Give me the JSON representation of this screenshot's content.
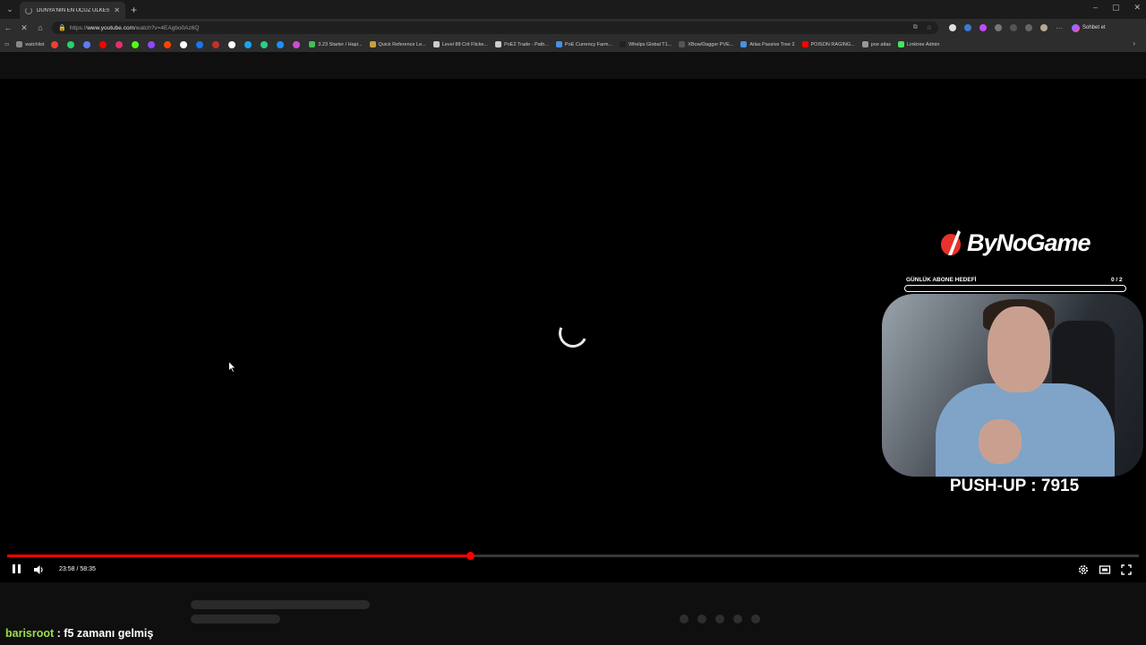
{
  "browser": {
    "tab_title": "DÜNYA'NIN EN UCUZ ÜLKESİ VİE",
    "url_prefix": "https://",
    "url_host": "www.youtube.com",
    "url_path": "/watch?v=4EAgbo0Az6Q",
    "chat_button": "Sohbet et",
    "window_controls": {
      "minimize": "–",
      "maximize": "▢",
      "close": "✕"
    }
  },
  "bookmarks": [
    {
      "label": "watchlist",
      "color": "#888888"
    },
    {
      "label": "",
      "color": "#ea4335"
    },
    {
      "label": "",
      "color": "#25d366"
    },
    {
      "label": "",
      "color": "#5b7cfa"
    },
    {
      "label": "",
      "color": "#ff0000"
    },
    {
      "label": "",
      "color": "#e1306c"
    },
    {
      "label": "",
      "color": "#53fc18"
    },
    {
      "label": "",
      "color": "#9146ff"
    },
    {
      "label": "",
      "color": "#ff4500"
    },
    {
      "label": "",
      "color": "#ffffff"
    },
    {
      "label": "",
      "color": "#1877f2"
    },
    {
      "label": "",
      "color": "#c4302b"
    },
    {
      "label": "",
      "color": "#ffffff"
    },
    {
      "label": "",
      "color": "#1da1f2"
    },
    {
      "label": "",
      "color": "#2dce89"
    },
    {
      "label": "",
      "color": "#1e90ff"
    },
    {
      "label": "",
      "color": "#d14bd1"
    },
    {
      "label": "3.23 Starter / Hapi...",
      "color": "#3fbf5a"
    },
    {
      "label": "Quick Reference Le...",
      "color": "#c8a13a"
    },
    {
      "label": "Level 88 Crit Flicke...",
      "color": "#cccccc"
    },
    {
      "label": "PoE2 Trade - Path...",
      "color": "#cccccc"
    },
    {
      "label": "PoE Currency Farm...",
      "color": "#4a90e2"
    },
    {
      "label": "Whelps Global T1...",
      "color": "#222222"
    },
    {
      "label": "XBow/Dagger PVE...",
      "color": "#555555"
    },
    {
      "label": "Atlas Passive Tree 2",
      "color": "#4a90e2"
    },
    {
      "label": "POISON RAGING...",
      "color": "#ff0000"
    },
    {
      "label": "poe atlas",
      "color": "#999999"
    },
    {
      "label": "Linktree Admin",
      "color": "#43e660"
    }
  ],
  "overlay": {
    "brand": "ByNoGame",
    "brand_color": "#e8322b",
    "goal_label": "GÜNLÜK ABONE HEDEFİ",
    "goal_count": "0 / 2",
    "goal_progress": 0,
    "pushup": "PUSH-UP : 7915"
  },
  "player": {
    "time_display": "23:58 / 58:35",
    "progress_fraction": 0.4093,
    "state": "loading",
    "progress_color": "#ff0000"
  },
  "chat": {
    "user": "barisroot",
    "message": " : f5 zamanı gelmiş"
  }
}
